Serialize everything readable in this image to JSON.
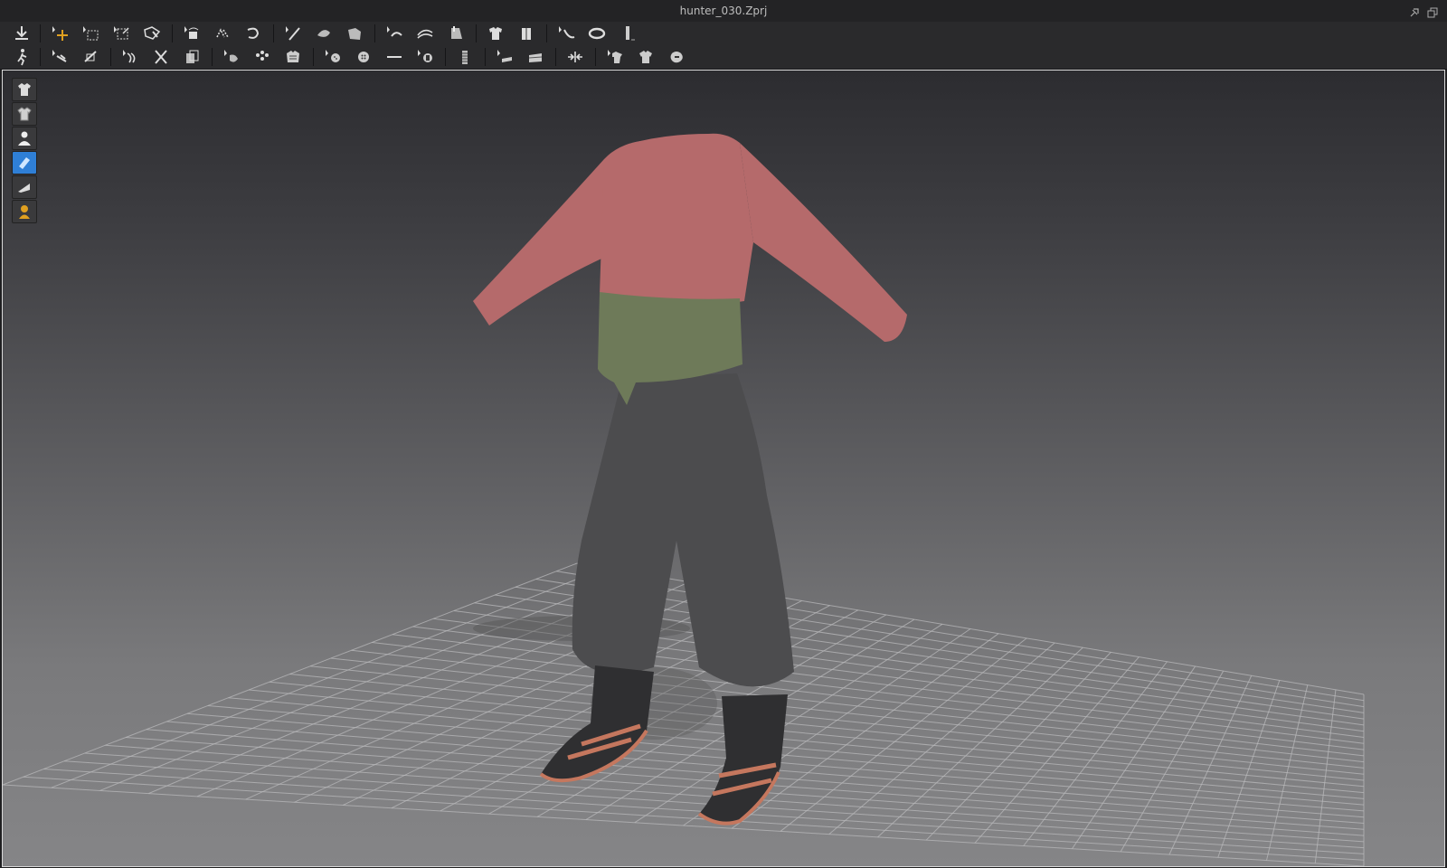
{
  "window": {
    "title": "hunter_030.Zprj"
  },
  "toolbar1": {
    "tools": [
      "save-down-icon",
      "transform-move-icon",
      "select-rect-icon",
      "transform-pattern-icon",
      "edit-texture-icon",
      "rotate-pattern-icon",
      "flip-pattern-icon",
      "undo-curve-icon",
      "pen-line-icon",
      "sculpt-icon",
      "fold-icon",
      "segment-select-icon",
      "sew-curve-icon",
      "tack-icon",
      "garment-front-icon",
      "garment-back-icon",
      "curve-edit-icon",
      "ring-icon",
      "ruler-icon"
    ]
  },
  "toolbar2": {
    "tools": [
      "avatar-walk-icon",
      "pin-icon",
      "pin-box-icon",
      "strap-icon",
      "cut-icon",
      "clone-icon",
      "fold-arrange-icon",
      "arrangement-points-icon",
      "puckering-icon",
      "button-add-icon",
      "button-icon",
      "line-measure-icon",
      "buttonhole-icon",
      "zipper-icon",
      "tape-icon",
      "piping-icon",
      "split-icon",
      "flat-pattern-icon",
      "shirt-icon",
      "reset-icon"
    ]
  },
  "side_panel": {
    "buttons": [
      "garment-shaded-icon",
      "garment-textured-icon",
      "avatar-show-icon",
      "measure-blue-icon",
      "flatten-icon",
      "avatar-skin-icon"
    ]
  },
  "colors": {
    "shirt": "#b56a6b",
    "sash": "#6e7a59",
    "pants": "#4c4c4e",
    "undershirt": "#8a8a8d",
    "boots": "#2f2f31",
    "shoe_trim": "#c5775e",
    "accent_icon": "#e0a020",
    "active_icon": "#2f7fd6"
  }
}
